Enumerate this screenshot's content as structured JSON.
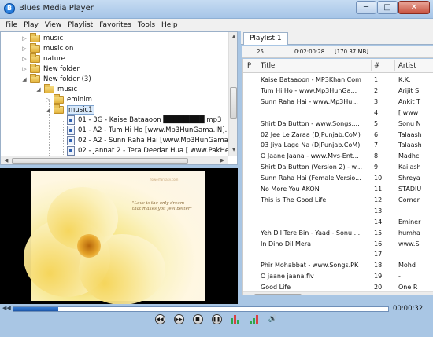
{
  "window": {
    "title": "Blues Media Player",
    "icon_letter": "B"
  },
  "window_controls": {
    "minimize": "─",
    "maximize": "□",
    "close": "✕"
  },
  "menu": [
    "File",
    "Play",
    "View",
    "Playlist",
    "Favorites",
    "Tools",
    "Help"
  ],
  "tree": {
    "items": [
      {
        "label": "music",
        "type": "folder",
        "expanded": false,
        "depth": 0
      },
      {
        "label": "music on",
        "type": "folder",
        "expanded": false,
        "depth": 0
      },
      {
        "label": "nature",
        "type": "folder",
        "expanded": false,
        "depth": 0
      },
      {
        "label": "New folder",
        "type": "folder",
        "expanded": false,
        "depth": 0
      },
      {
        "label": "New folder (3)",
        "type": "folder",
        "expanded": true,
        "depth": 0
      },
      {
        "label": "music",
        "type": "folder",
        "expanded": true,
        "depth": 1
      },
      {
        "label": "eminim",
        "type": "folder",
        "expanded": false,
        "depth": 2
      },
      {
        "label": "music1",
        "type": "folder",
        "expanded": true,
        "depth": 2,
        "selected": true
      },
      {
        "label": "01 - 3G - Kaise Bataaoon ████████ mp3",
        "type": "file",
        "depth": 3
      },
      {
        "label": "01 - A2 - Tum Hi Ho [www.Mp3HunGama.IN].m",
        "type": "file",
        "depth": 3
      },
      {
        "label": "02 - A2 - Sunn Raha Hai [www.Mp3HunGama.IN",
        "type": "file",
        "depth": 3
      },
      {
        "label": "02 - Jannat 2 - Tera Deedar Hua [ www.PakHe",
        "type": "file",
        "depth": 3
      }
    ]
  },
  "video": {
    "quote": "\"Love is the only dream that makes you feel better\"",
    "site": "flowerfantasy.com"
  },
  "playlist": {
    "tab_label": "Playlist 1",
    "track_count": "25",
    "total_time": "0:02:00:28",
    "total_size": "[170.37 MB]",
    "columns": {
      "p": "P",
      "title": "Title",
      "num": "#",
      "artist": "Artist"
    },
    "rows": [
      {
        "title": "Kaise Bataaoon - MP3Khan.Com",
        "num": "1",
        "artist": "K.K."
      },
      {
        "title": "Tum Hi Ho - www.Mp3HunGa...",
        "num": "2",
        "artist": "Arijit S"
      },
      {
        "title": "Sunn Raha Hai - www.Mp3Hu...",
        "num": "3",
        "artist": "Ankit T"
      },
      {
        "title": "",
        "num": "4",
        "artist": "[ www"
      },
      {
        "title": "Shirt Da Button - www.Songs....",
        "num": "5",
        "artist": "Sonu N"
      },
      {
        "title": "02 Jee Le Zaraa (DjPunjab.CoM)",
        "num": "6",
        "artist": "Talaash"
      },
      {
        "title": "03 Jiya Lage Na (DjPunjab.CoM)",
        "num": "7",
        "artist": "Talaash"
      },
      {
        "title": "O Jaane Jaana - www.Mvs-Ent...",
        "num": "8",
        "artist": "Madhc"
      },
      {
        "title": "Shirt Da Button (Version 2) - w...",
        "num": "9",
        "artist": "Kailash"
      },
      {
        "title": "Sunn Raha Hai (Female Versio...",
        "num": "10",
        "artist": "Shreya"
      },
      {
        "title": "No More You AKON",
        "num": "11",
        "artist": "STADIU"
      },
      {
        "title": "This is The Good Life",
        "num": "12",
        "artist": "Corner"
      },
      {
        "title": "",
        "num": "13",
        "artist": ""
      },
      {
        "title": "",
        "num": "14",
        "artist": "Eminer"
      },
      {
        "title": "Yeh Dil Tere Bin - Yaad - Sonu ...",
        "num": "15",
        "artist": "humha"
      },
      {
        "title": "In Dino Dil Mera",
        "num": "16",
        "artist": "www.S"
      },
      {
        "title": "",
        "num": "17",
        "artist": ""
      },
      {
        "title": "Phir Mohabbat - www.Songs.PK",
        "num": "18",
        "artist": "Mohd"
      },
      {
        "title": "O jaane jaana.flv",
        "num": "19",
        "artist": "-"
      },
      {
        "title": "Good Life",
        "num": "20",
        "artist": "One R"
      }
    ]
  },
  "transport": {
    "elapsed": "00:00:32",
    "progress_fraction": 0.12,
    "rewind_icon": "◀◀",
    "buttons": [
      "previous",
      "next",
      "stop",
      "pause"
    ],
    "volume_icon": "🔊"
  },
  "colors": {
    "accent": "#1d56a8",
    "folder": "#e3b33c",
    "chrome": "#a9c6e4"
  }
}
